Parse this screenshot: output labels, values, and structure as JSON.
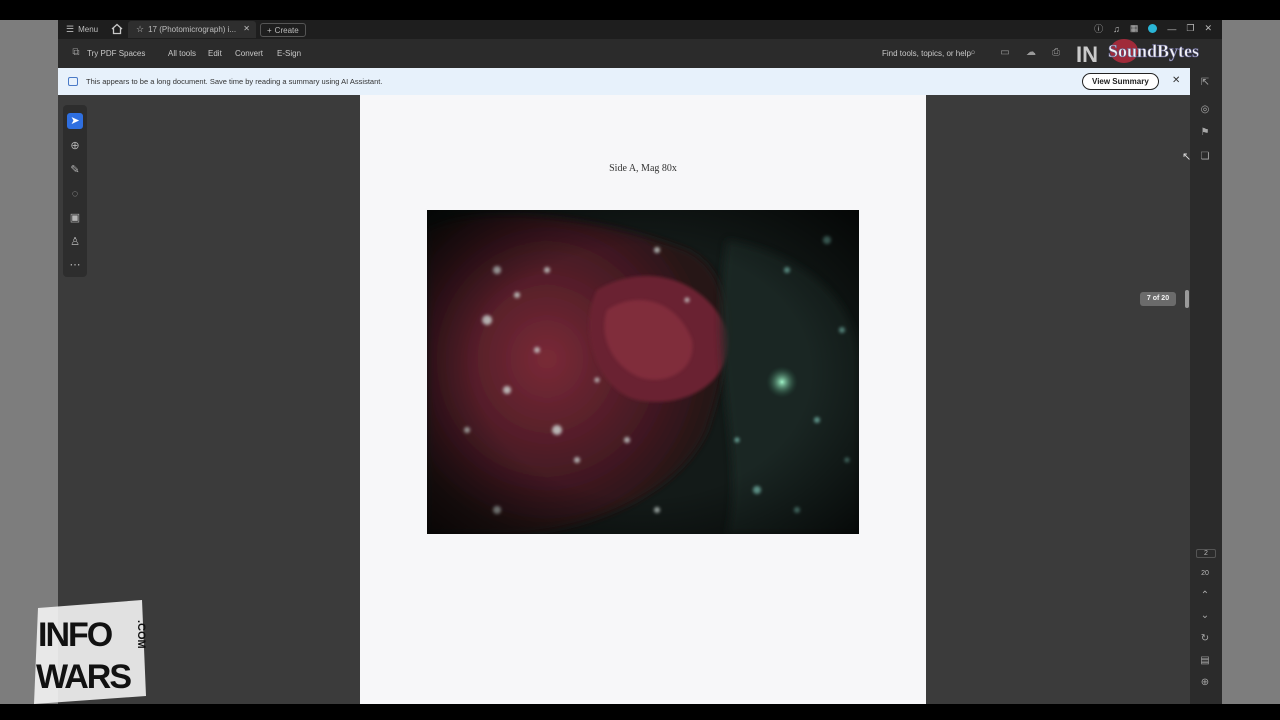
{
  "titlebar": {
    "menu_label": "Menu",
    "tab_title": "17 (Photomicrograph) i...",
    "create_label": "Create"
  },
  "toolbar": {
    "pdf_spaces": "Try PDF Spaces",
    "all_tools": "All tools",
    "edit": "Edit",
    "convert": "Convert",
    "esign": "E-Sign",
    "search_placeholder": "Find tools, topics, or help"
  },
  "banner": {
    "message": "This appears to be a long document. Save time by reading a summary using AI Assistant.",
    "button": "View Summary"
  },
  "document": {
    "caption": "Side A, Mag 80x",
    "page_indicator": "7 of 20"
  },
  "right_rail": {
    "current_page": "2",
    "total_pages": "20"
  },
  "watermarks": {
    "infowars_line1": "INFO",
    "infowars_line2": "WARS",
    "infowars_side": ".COM",
    "soundbytes": "SoundBytes",
    "overlay_text": "IN"
  },
  "colors": {
    "accent": "#2f6fe0",
    "banner_bg": "#e7f1fb",
    "workspace": "#3b3b3b"
  }
}
